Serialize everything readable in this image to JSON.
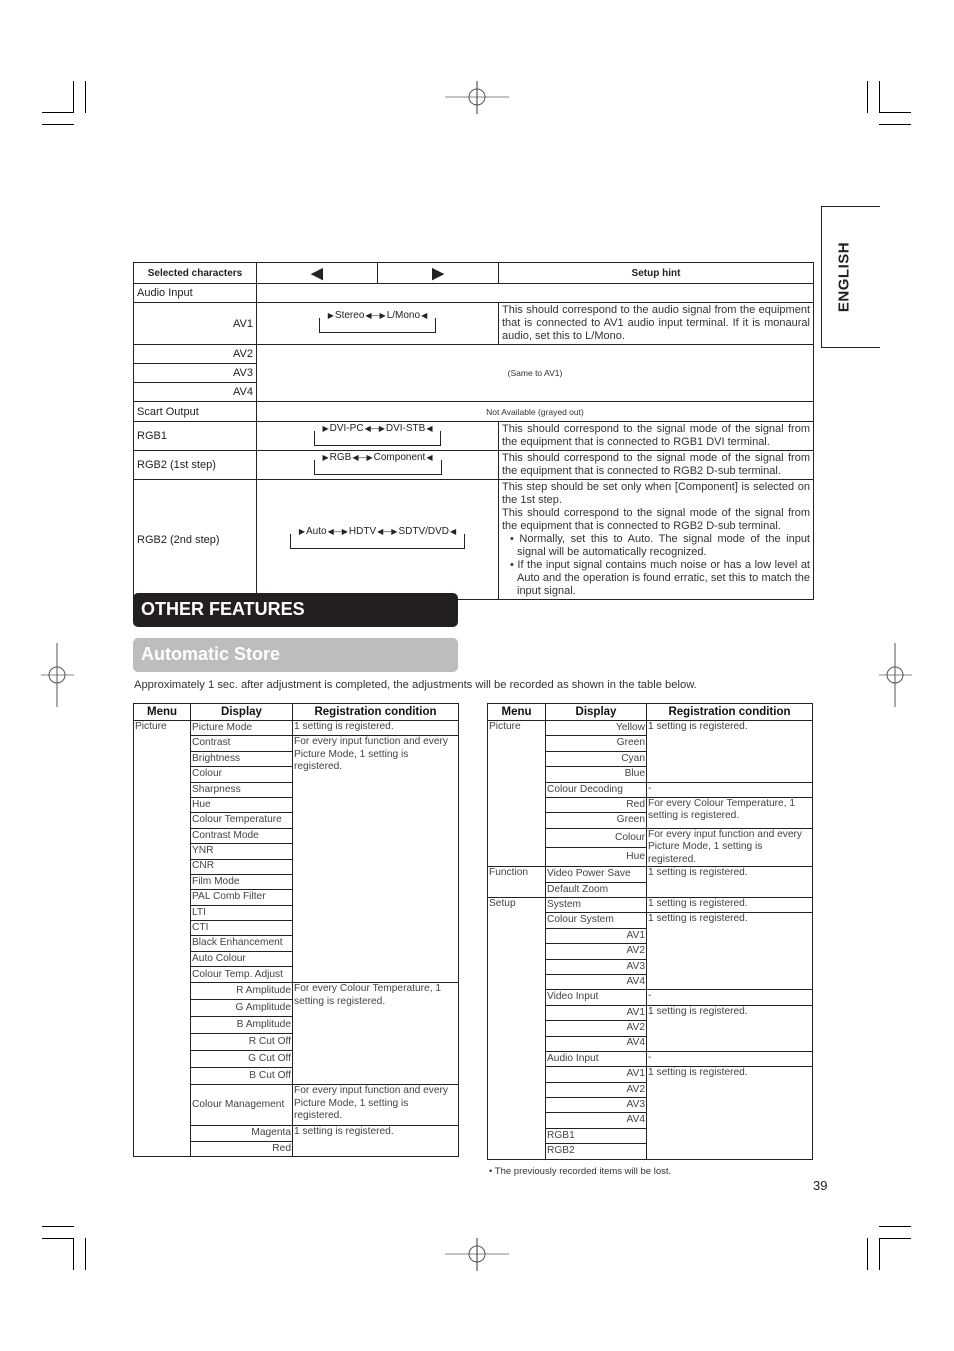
{
  "side_tab": {
    "label": "ENGLISH"
  },
  "top_table": {
    "headers": {
      "selected": "Selected characters",
      "left_arrow_icon": "◀",
      "right_arrow_icon": "▶",
      "hint": "Setup hint"
    },
    "audio_input_label": "Audio Input",
    "av1": {
      "label": "AV1",
      "cycle": [
        "Stereo",
        "L/Mono"
      ],
      "hint": "This should correspond to the audio signal from the equipment that is connected to AV1 audio input terminal. If it is monaural audio, set this to L/Mono."
    },
    "av_others": [
      "AV2",
      "AV3",
      "AV4"
    ],
    "same_note": "(Same to AV1)",
    "scart": {
      "label": "Scart Output",
      "value": "Not Available (grayed out)"
    },
    "rgb1": {
      "label": "RGB1",
      "cycle": [
        "DVI-PC",
        "DVI-STB"
      ],
      "hint": "This should correspond to the signal mode of the signal from the equipment that is connected to RGB1 DVI terminal."
    },
    "rgb2_1": {
      "label": "RGB2 (1st step)",
      "cycle": [
        "RGB",
        "Component"
      ],
      "hint": "This should correspond to the signal mode of the signal from the equipment that is connected to RGB2 D-sub terminal."
    },
    "rgb2_2": {
      "label": "RGB2 (2nd step)",
      "cycle": [
        "Auto",
        "HDTV",
        "SDTV/DVD"
      ],
      "hint_lines": [
        "This step should be set only when [Component] is selected on the 1st step.",
        "This should correspond to the signal mode of the signal from the equipment that is connected to RGB2 D-sub terminal."
      ],
      "bullets": [
        "• Normally, set this to Auto. The signal mode of the input signal will be automatically recognized.",
        "• If the input signal contains much noise or has a low level at Auto and the operation is found erratic, set this to match the input signal."
      ]
    }
  },
  "section_title": "OTHER FEATURES",
  "subsection_title": "Automatic Store",
  "intro": "Approximately 1 sec. after adjustment is completed, the adjustments will be recorded as shown in the table below.",
  "store_headers": {
    "menu": "Menu",
    "display": "Display",
    "condition": "Registration condition"
  },
  "left_table": {
    "menu": "Picture",
    "rows": [
      "Picture Mode",
      "Contrast",
      "Brightness",
      "Colour",
      "Sharpness",
      "Hue",
      "Colour Temperature",
      "Contrast Mode",
      "YNR",
      "CNR",
      "Film Mode",
      "PAL Comb Filter",
      "LTI",
      "CTI",
      "Black Enhancement",
      "Auto Colour",
      "Colour Temp. Adjust",
      "R Amplitude",
      "G Amplitude",
      "B Amplitude",
      "R Cut Off",
      "G Cut Off",
      "B Cut Off",
      "Colour Management",
      "Magenta",
      "Red"
    ],
    "conditions": {
      "c1": "1 setting is registered.",
      "c2": "For every input function and every Picture Mode, 1 setting is registered.",
      "c3": "For every Colour Temperature, 1 setting is registered.",
      "c4": "For every input function and every Picture Mode, 1 setting is registered.",
      "c5": "1 setting is registered."
    }
  },
  "right_table": {
    "menus": {
      "picture": "Picture",
      "function": "Function",
      "setup": "Setup"
    },
    "rows": [
      "Yellow",
      "Green",
      "Cyan",
      "Blue",
      "Colour Decoding",
      "Red",
      "Green",
      "Colour",
      "Hue",
      "Video Power Save",
      "Default Zoom",
      "System",
      "Colour System",
      "AV1",
      "AV2",
      "AV3",
      "AV4",
      "Video Input",
      "AV1",
      "AV2",
      "AV4",
      "Audio Input",
      "AV1",
      "AV2",
      "AV3",
      "AV4",
      "RGB1",
      "RGB2"
    ],
    "conditions": {
      "c1": "1 setting is registered.",
      "c2": "-",
      "c3": "For every Colour Temperature, 1 setting is registered.",
      "c4": "For every input function and every Picture Mode, 1 setting is registered.",
      "c5": "1 setting is registered.",
      "c6": "1 setting is registered.",
      "c7": "1 setting is registered.",
      "c8": "-",
      "c9": "1 setting is registered.",
      "c10": "-",
      "c11": "1 setting is registered."
    }
  },
  "footnote": "• The previously recorded items will be lost.",
  "page_number": "39"
}
